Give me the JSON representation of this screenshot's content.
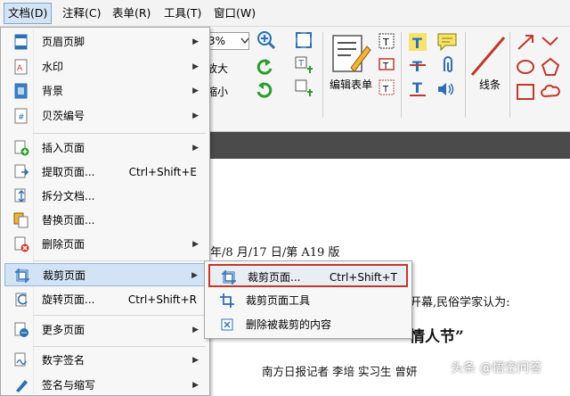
{
  "menubar": {
    "items": [
      "文档(D)",
      "注释(C)",
      "表单(R)",
      "工具(T)",
      "窗口(W)"
    ]
  },
  "toolbar": {
    "zoom_value": "3%",
    "zoom_in_label": "放大",
    "zoom_out_label": "缩小",
    "edit_form_label": "编辑表单",
    "line_label": "线条"
  },
  "document": {
    "line1": "年/8 月/17 日/第 A19 版",
    "line2": "开幕,民俗学家认为:",
    "line3": "情人节”",
    "byline": "南方日报记者    李培    实习生    曾妍"
  },
  "doc_menu": {
    "items": [
      {
        "label": "页眉页脚",
        "shortcut": "",
        "submenu": true
      },
      {
        "label": "水印",
        "shortcut": "",
        "submenu": true
      },
      {
        "label": "背景",
        "shortcut": "",
        "submenu": true
      },
      {
        "label": "贝茨编号",
        "shortcut": "",
        "submenu": true
      },
      {
        "label": "插入页面",
        "shortcut": "",
        "submenu": true
      },
      {
        "label": "提取页面...",
        "shortcut": "Ctrl+Shift+E",
        "submenu": false
      },
      {
        "label": "拆分文档...",
        "shortcut": "",
        "submenu": false
      },
      {
        "label": "替换页面...",
        "shortcut": "",
        "submenu": false
      },
      {
        "label": "删除页面",
        "shortcut": "",
        "submenu": true
      },
      {
        "label": "裁剪页面",
        "shortcut": "",
        "submenu": true
      },
      {
        "label": "旋转页面...",
        "shortcut": "Ctrl+Shift+R",
        "submenu": false
      },
      {
        "label": "更多页面",
        "shortcut": "",
        "submenu": true
      },
      {
        "label": "数字签名",
        "shortcut": "",
        "submenu": true
      },
      {
        "label": "签名与缩写",
        "shortcut": "",
        "submenu": true
      }
    ]
  },
  "crop_submenu": {
    "items": [
      {
        "label": "裁剪页面...",
        "shortcut": "Ctrl+Shift+T"
      },
      {
        "label": "裁剪页面工具",
        "shortcut": ""
      },
      {
        "label": "删除被裁剪的内容",
        "shortcut": ""
      }
    ]
  },
  "watermark": {
    "text": "头条 @悟空问答"
  },
  "colors": {
    "highlight": "#d2e3f5",
    "highlight_border": "#8fb6df",
    "submenu_focus_border": "#c0392b",
    "dark_band": "#4b4b4b"
  }
}
